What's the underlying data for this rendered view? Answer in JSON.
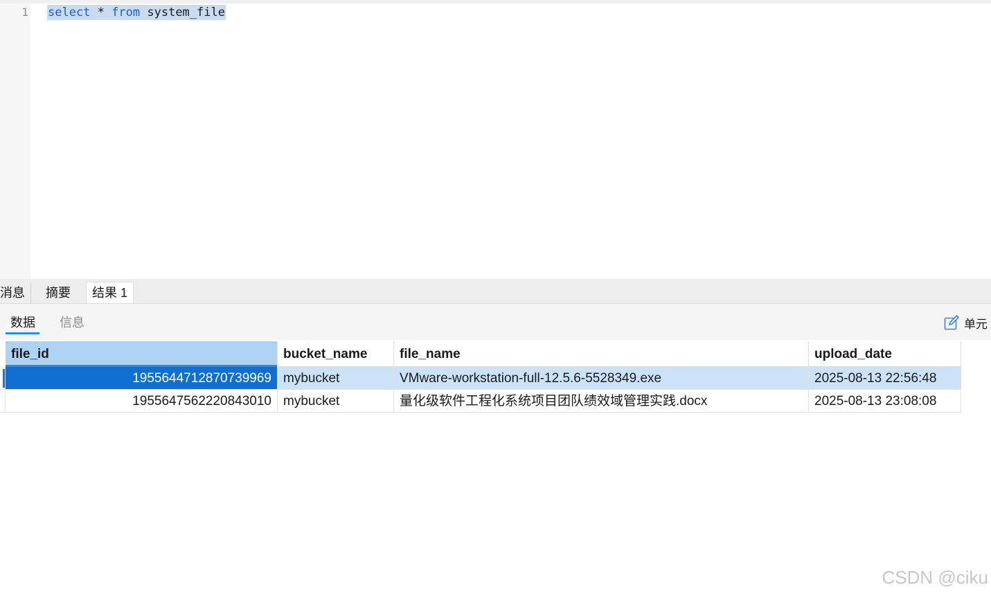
{
  "editor": {
    "line_number": "1",
    "kw_select": "select",
    "op_star": "*",
    "kw_from": "from",
    "table_name": "system_file"
  },
  "result_tabs": [
    {
      "label": "消息"
    },
    {
      "label": "摘要"
    },
    {
      "label": "结果 1"
    }
  ],
  "sub_tabs": {
    "data_label": "数据",
    "info_label": "信息"
  },
  "toolbar": {
    "cell_edit_label": "单元"
  },
  "grid": {
    "columns": [
      "file_id",
      "bucket_name",
      "file_name",
      "upload_date"
    ],
    "rows": [
      [
        "1955644712870739969",
        "mybucket",
        "VMware-workstation-full-12.5.6-5528349.exe",
        "2025-08-13 22:56:48"
      ],
      [
        "1955647562220843010",
        "mybucket",
        "量化级软件工程化系统项目团队绩效域管理实践.docx",
        "2025-08-13 23:08:08"
      ]
    ]
  },
  "watermark": "CSDN @ciku"
}
